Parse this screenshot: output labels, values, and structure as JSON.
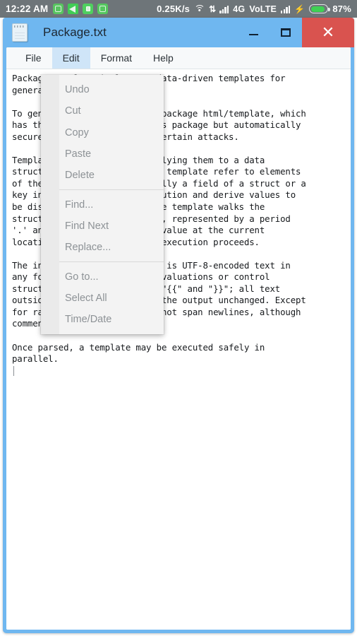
{
  "statusbar": {
    "clock": "12:22 AM",
    "notification_icons": [
      "app-notification-icon",
      "media-play-icon",
      "battery-saver-icon",
      "app-notification-icon"
    ],
    "data_rate": "0.25K/s",
    "wifi_icon": "wifi-icon",
    "data_transfer_icon": "data-transfer-icon",
    "signal_icon": "signal-bars-icon",
    "network_type": "4G",
    "volte": "VoLTE",
    "signal_icon_2": "signal-bars-icon",
    "charging_icon": "charging-bolt-icon",
    "battery_level": "87%",
    "battery_fill_pct": 87,
    "bar_bg": "#6e7579",
    "accent_green": "#3fd154"
  },
  "window": {
    "title": "Package.txt",
    "app_icon": "notepad-icon",
    "titlebar_color": "#6fb7f0",
    "close_color": "#d9534f",
    "controls": {
      "minimize": "minimize-icon",
      "maximize": "maximize-icon",
      "close": "✕"
    }
  },
  "menubar": {
    "items": [
      {
        "label": "File",
        "active": false
      },
      {
        "label": "Edit",
        "active": true
      },
      {
        "label": "Format",
        "active": false
      },
      {
        "label": "Help",
        "active": false
      }
    ]
  },
  "edit_menu": {
    "open": true,
    "groups": [
      {
        "items": [
          "Undo",
          "Cut",
          "Copy",
          "Paste",
          "Delete"
        ]
      },
      {
        "items": [
          "Find...",
          "Find Next",
          "Replace..."
        ]
      },
      {
        "items": [
          "Go to...",
          "Select All",
          "Time/Date"
        ]
      }
    ]
  },
  "editor": {
    "content": "Package template implements data-driven templates for\ngenerating textual output.\n\nTo generate HTML output, see package html/template, which\nhas the same interface as this package but automatically\nsecures HTML output against certain attacks.\n\nTemplates are executed by applying them to a data\nstructure. Annotations in the template refer to elements\nof the data structure (typically a field of a struct or a\nkey in a map) to control execution and derive values to\nbe displayed. Execution of the template walks the\nstructure and sets the cursor, represented by a period\n'.' and called \"dot\", to the value at the current\nlocation in the structure as execution proceeds.\n\nThe input text for a template is UTF-8-encoded text in\nany format. \"Actions\"--data evaluations or control\nstructures--are delimited by \"{{\" and \"}}\"; all text\noutside actions is copied to the output unchanged. Except\nfor raw strings, actions may not span newlines, although\ncomments can.\n\nOnce parsed, a template may be executed safely in\nparallel.",
    "caret_visible": true
  }
}
